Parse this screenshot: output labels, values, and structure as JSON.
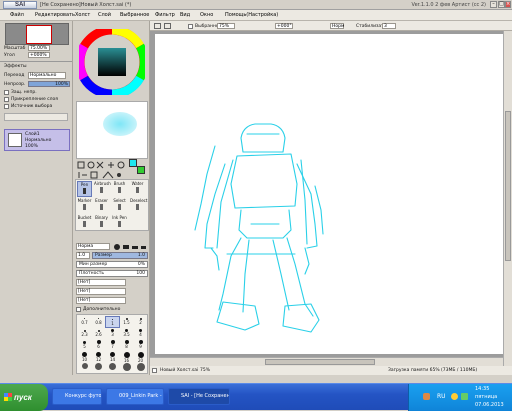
{
  "titlebar": {
    "logo": "PaintTool SAI",
    "title": "[Не Сохранено]Новый Холст.sai (*)",
    "version": "Ver.1.1.0 2 фев Артист (cc 2)"
  },
  "menubar": {
    "items": [
      "Файл",
      "Редактировать",
      "Холст",
      "Слой",
      "Выбранное",
      "Фильтр",
      "Вид",
      "Окно",
      "Помощь(Настройка)"
    ]
  },
  "toolopts": {
    "select_label": "Выбранное",
    "zoom1": "75%",
    "zoom2": "+000°",
    "mode": "Норм",
    "stab_label": "Стабилизатор",
    "stab_value": "3"
  },
  "navigator": {
    "zoom": "75.00%",
    "angle": "+000%",
    "zoom_label": "Масштаб",
    "angle_label": "Угол"
  },
  "layer": {
    "effects": "Эффекты",
    "mode_label": "Переход",
    "mode": "Нормально",
    "opacity_label": "Непрозр.",
    "opacity": "100%",
    "options": [
      "Защ. непр.",
      "Прикрепление слоя",
      "Источник выбора"
    ],
    "name": "Слой1",
    "name_mode": "Нормально",
    "name_opacity": "100%"
  },
  "colors": {
    "fg": "#1de8f0",
    "bg": "#ffffff",
    "accent": "#33cc33"
  },
  "tools": {
    "row1": [
      "Pen",
      "Airbrush",
      "Brush",
      "Water"
    ],
    "row2": [
      "Marker",
      "Eraser",
      "Select",
      "Deselect"
    ],
    "row3": [
      "Bucket",
      "Binary",
      "Ink Pen"
    ]
  },
  "brush": {
    "mode": "Норма",
    "size_label": "Размер",
    "size_mult": "1.0",
    "size": "1.0",
    "min_size_label": "Мин размер",
    "min_size": "0%",
    "density_label": "Плотность",
    "density": "100",
    "tex1": "[Нет]",
    "tex2": "[Нет]",
    "tex3": "[Нет]",
    "extra": "Дополнительно"
  },
  "sizes": [
    "0.7",
    "0.8",
    "1",
    "1.5",
    "2",
    "2.3",
    "2.6",
    "3",
    "3.5",
    "4",
    "5",
    "6",
    "7",
    "8",
    "9",
    "10",
    "12",
    "14",
    "16",
    "20",
    "25",
    "30",
    "35",
    "40",
    "50",
    "60",
    "70",
    "80",
    "100",
    "120",
    "160",
    "200",
    "250",
    "300",
    "350"
  ],
  "status": {
    "name": "Новый Холст.sai",
    "zoom": "75%",
    "memory": "Загрузка памяти 65% (73МБ / 110МБ)"
  },
  "taskbar": {
    "start": "пуск",
    "tasks": [
      "Конкурс футов про...",
      "009_Linkin Park - Valk...",
      "SAI - [Не Сохранено..."
    ],
    "lang": "RU",
    "time": "14:35",
    "day": "пятница",
    "date": "07.06.2013"
  }
}
